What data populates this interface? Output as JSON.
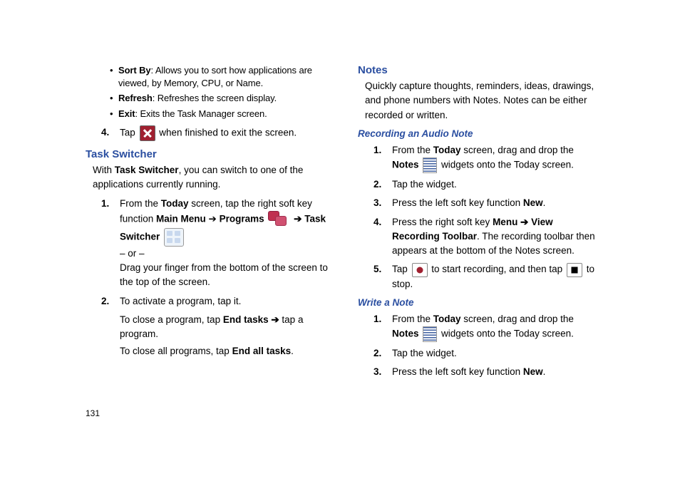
{
  "page_number": "131",
  "left": {
    "bullets": [
      {
        "label": "Sort By",
        "desc": ": Allows you to sort how applications are viewed, by Memory, CPU, or Name."
      },
      {
        "label": "Refresh",
        "desc": ": Refreshes the screen display."
      },
      {
        "label": "Exit",
        "desc": ": Exits the Task Manager screen."
      }
    ],
    "step4": {
      "num": "4.",
      "pre": "Tap ",
      "post": " when finished to exit the screen."
    },
    "heading": "Task Switcher",
    "intro_pre": "With ",
    "intro_bold": "Task Switcher",
    "intro_post": ", you can switch to one of the applications currently running.",
    "s1": {
      "num": "1.",
      "p1a": "From the ",
      "p1b": "Today",
      "p1c": " screen, tap the right soft key function ",
      "p1d": "Main Menu ",
      "arrow1": "➔",
      "p1e": " Programs ",
      "arrow2": " ➔ ",
      "p1f": "Task Switcher ",
      "or": "– or –",
      "drag": "Drag your finger from the bottom of the screen to the top of the screen."
    },
    "s2": {
      "num": "2.",
      "line1": "To activate a program, tap it.",
      "line2a": "To close a program, tap ",
      "line2b": "End tasks ➔",
      "line2c": " tap a program.",
      "line3a": "To close all programs, tap ",
      "line3b": "End all tasks",
      "line3c": "."
    }
  },
  "right": {
    "heading_notes": "Notes",
    "notes_intro": "Quickly capture thoughts, reminders, ideas, drawings, and phone numbers with Notes. Notes can be either recorded or written.",
    "heading_rec": "Recording an Audio Note",
    "r1": {
      "num": "1.",
      "a": "From the ",
      "b": "Today",
      "c": " screen, drag and drop the ",
      "d": "Notes",
      "e": " widgets onto the Today screen."
    },
    "r2": {
      "num": "2.",
      "text": "Tap the widget."
    },
    "r3": {
      "num": "3.",
      "a": "Press the left soft key function ",
      "b": "New",
      "c": "."
    },
    "r4": {
      "num": "4.",
      "a": "Press the right soft key ",
      "b": "Menu ➔ View Recording Toolbar",
      "c": ". The recording toolbar then appears at the bottom of the Notes screen."
    },
    "r5": {
      "num": "5.",
      "a": "Tap ",
      "b": " to start recording, and then tap ",
      "c": " to stop."
    },
    "heading_write": "Write a Note",
    "w1": {
      "num": "1.",
      "a": "From the ",
      "b": "Today",
      "c": " screen, drag and drop the ",
      "d": "Notes",
      "e": " widgets onto the Today screen."
    },
    "w2": {
      "num": "2.",
      "text": "Tap the widget."
    },
    "w3": {
      "num": "3.",
      "a": "Press the left soft key function ",
      "b": "New",
      "c": "."
    }
  }
}
